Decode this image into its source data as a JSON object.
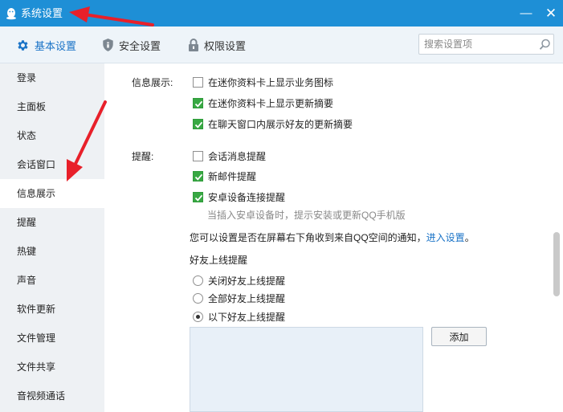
{
  "window": {
    "title": "系统设置",
    "minimize_symbol": "—",
    "close_symbol": "✕"
  },
  "toolbar": {
    "tabs": [
      {
        "label": "基本设置",
        "icon": "gear-icon",
        "active": true
      },
      {
        "label": "安全设置",
        "icon": "shield-icon",
        "active": false
      },
      {
        "label": "权限设置",
        "icon": "lock-icon",
        "active": false
      }
    ],
    "search_placeholder": "搜索设置项"
  },
  "sidebar": {
    "items": [
      {
        "label": "登录"
      },
      {
        "label": "主面板"
      },
      {
        "label": "状态"
      },
      {
        "label": "会话窗口"
      },
      {
        "label": "信息展示",
        "active": true
      },
      {
        "label": "提醒"
      },
      {
        "label": "热键"
      },
      {
        "label": "声音"
      },
      {
        "label": "软件更新"
      },
      {
        "label": "文件管理"
      },
      {
        "label": "文件共享"
      },
      {
        "label": "音视频通话"
      }
    ]
  },
  "content": {
    "info_display": {
      "label": "信息展示:",
      "options": [
        {
          "label": "在迷你资料卡上显示业务图标",
          "checked": false
        },
        {
          "label": "在迷你资料卡上显示更新摘要",
          "checked": true
        },
        {
          "label": "在聊天窗口内展示好友的更新摘要",
          "checked": true
        }
      ]
    },
    "reminder": {
      "label": "提醒:",
      "options": [
        {
          "label": "会话消息提醒",
          "checked": false
        },
        {
          "label": "新邮件提醒",
          "checked": true
        },
        {
          "label": "安卓设备连接提醒",
          "checked": true
        }
      ],
      "android_hint": "当插入安卓设备时，提示安装或更新QQ手机版"
    },
    "qzone_note": {
      "text": "您可以设置是否在屏幕右下角收到来自QQ空间的通知，",
      "link": "进入设置",
      "suffix": "。"
    },
    "friend_online": {
      "title": "好友上线提醒",
      "options": [
        {
          "label": "关闭好友上线提醒",
          "selected": false
        },
        {
          "label": "全部好友上线提醒",
          "selected": false
        },
        {
          "label": "以下好友上线提醒",
          "selected": true
        }
      ],
      "add_button": "添加"
    }
  },
  "colors": {
    "titlebar": "#1e8fd6",
    "toolbar": "#eef4f9",
    "sidebar": "#eef1f4",
    "accent": "#1a73c7",
    "check_green": "#38a843",
    "annotation_arrow": "#e8202a"
  }
}
